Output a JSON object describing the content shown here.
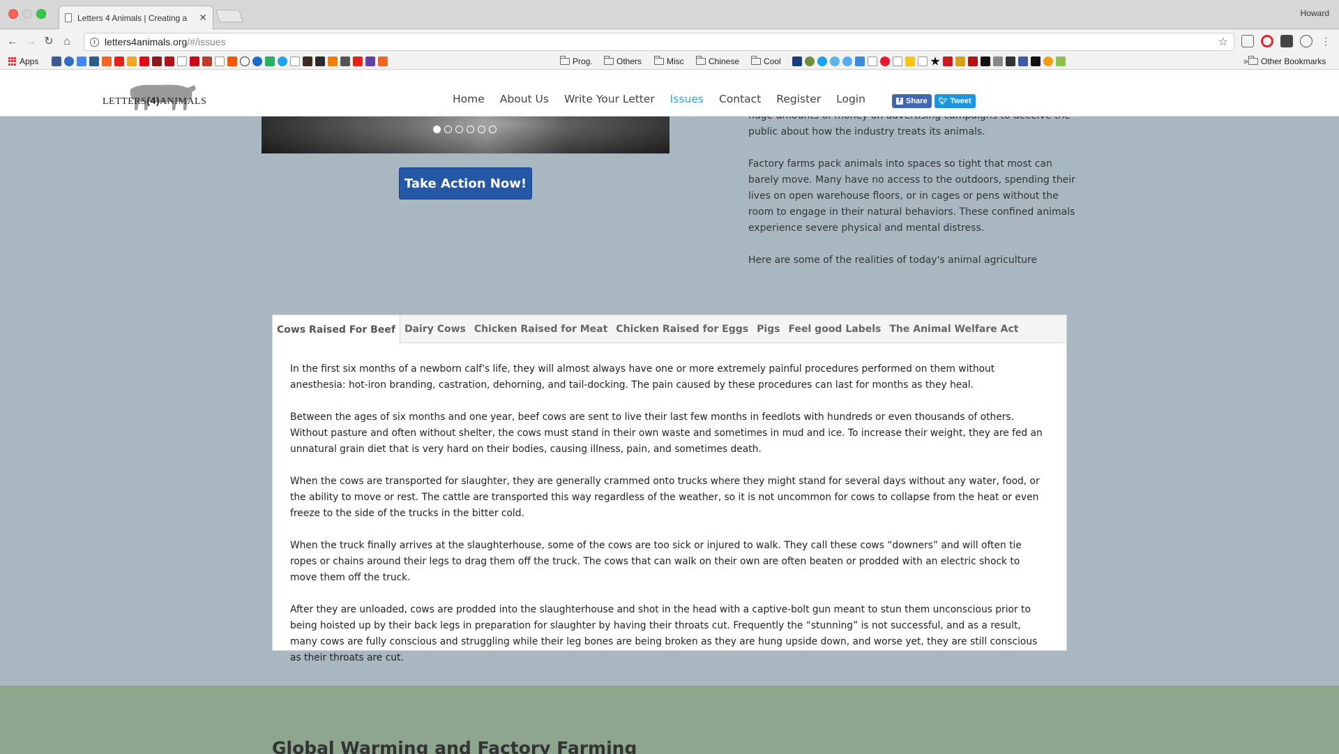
{
  "browser": {
    "tab_title": "Letters 4 Animals | Creating a",
    "profile_name": "Howard",
    "url_host": "letters4animals.org",
    "url_path": "/#/issues",
    "bookmarks": [
      "Apps",
      "Prog.",
      "Others",
      "Misc",
      "Chinese",
      "Cool",
      "Other Bookmarks"
    ]
  },
  "site": {
    "logo_text_left": "LETTERS",
    "logo_text_mid": "(4)",
    "logo_text_right": "ANIMALS",
    "nav": [
      "Home",
      "About Us",
      "Write Your Letter",
      "Issues",
      "Contact",
      "Register",
      "Login"
    ],
    "active_nav": "Issues",
    "share_label": "Share",
    "tweet_label": "Tweet"
  },
  "intro": {
    "cta_label": "Take Action Now!",
    "paragraphs": [
      "huge amounts of money on advertising campaigns to deceive the public about how the industry treats its animals.",
      "Factory farms pack animals into spaces so tight that most can barely move. Many have no access to the outdoors, spending their lives on open warehouse floors, or in cages or pens without the room to engage in their natural behaviors. These confined animals experience severe physical and mental distress.",
      "Here are some of the realities of today's animal agriculture industries:"
    ]
  },
  "issue_tabs": {
    "labels": [
      "Cows Raised For Beef",
      "Dairy Cows",
      "Chicken Raised for Meat",
      "Chicken Raised for Eggs",
      "Pigs",
      "Feel good Labels",
      "The Animal Welfare Act"
    ],
    "active": "Cows Raised For Beef",
    "content": [
      "In the first six months of a newborn calf's life, they will almost always have one or more extremely painful procedures performed on them without anesthesia: hot-iron branding, castration, dehorning, and tail-docking. The pain caused by these procedures can last for months as they heal.",
      "Between the ages of six months and one year, beef cows are sent to live their last few months in feedlots with hundreds or even thousands of others. Without pasture and often without shelter, the cows must stand in their own waste and sometimes in mud and ice. To increase their weight, they are fed an unnatural grain diet that is very hard on their bodies, causing illness, pain, and sometimes death.",
      "When the cows are transported for slaughter, they are generally crammed onto trucks where they might stand for several days without any water, food, or the ability to move or rest. The cattle are transported this way regardless of the weather, so it is not uncommon for cows to collapse from the heat or even freeze to the side of the trucks in the bitter cold.",
      "When the truck finally arrives at the slaughterhouse, some of the cows are too sick or injured to walk. They call these cows “downers” and will often tie ropes or chains around their legs to drag them off the truck. The cows that can walk on their own are often beaten or prodded with an electric shock to move them off the truck.",
      "After they are unloaded, cows are prodded into the slaughterhouse and shot in the head with a captive-bolt gun meant to stun them unconscious prior to being hoisted up by their back legs in preparation for slaughter by having their throats cut. Frequently the “stunning” is not successful, and as a result, many cows are fully conscious and struggling while their leg bones are being broken as they are hung upside down, and worse yet, they are still conscious as their throats are cut."
    ]
  },
  "next_section": {
    "title": "Global Warming and Factory Farming"
  }
}
